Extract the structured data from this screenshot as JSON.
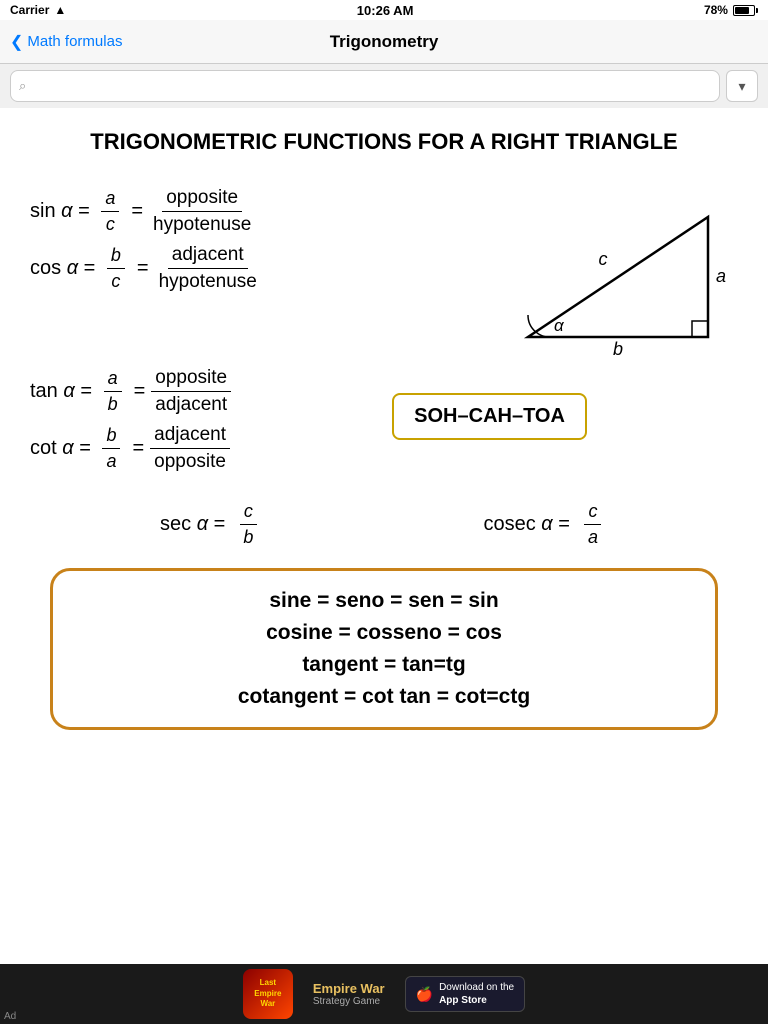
{
  "status": {
    "carrier": "Carrier",
    "wifi": "WiFi",
    "time": "10:26 AM",
    "battery": "78%"
  },
  "nav": {
    "back_label": "Math formulas",
    "title": "Trigonometry"
  },
  "search": {
    "placeholder": "",
    "dropdown_label": "▼"
  },
  "page": {
    "title": "TRIGONOMETRIC FUNCTIONS FOR A RIGHT TRIANGLE"
  },
  "formulas": {
    "sin_label": "sin α =",
    "sin_num": "a",
    "sin_den": "c",
    "sin_eq": "=",
    "sin_word_num": "opposite",
    "sin_word_den": "hypotenuse",
    "cos_label": "cos α =",
    "cos_num": "b",
    "cos_den": "c",
    "cos_eq": "=",
    "cos_word_num": "adjacent",
    "cos_word_den": "hypotenuse",
    "tan_label": "tan α =",
    "tan_num": "a",
    "tan_den": "b",
    "tan_eq": "=",
    "tan_word_num": "opposite",
    "tan_word_den": "adjacent",
    "cot_label": "cot α =",
    "cot_num": "b",
    "cot_den": "a",
    "cot_eq": "=",
    "cot_word_num": "adjacent",
    "cot_word_den": "opposite",
    "sec_label": "sec α =",
    "sec_num": "c",
    "sec_den": "b",
    "cosec_label": "cosec α =",
    "cosec_num": "c",
    "cosec_den": "a"
  },
  "sohtoa": {
    "label": "SOH–CAH–TOA"
  },
  "triangle": {
    "side_a": "a",
    "side_b": "b",
    "side_c": "c",
    "angle": "α"
  },
  "equivalences": {
    "line1": "sine = seno = sen = sin",
    "line2": "cosine = cosseno = cos",
    "line3": "tangent = tan=tg",
    "line4": "cotangent = cot tan = cot=ctg"
  },
  "ad": {
    "game_title": "Last\nEmpire\nWar",
    "app_store_label": "Download on the\nApp Store",
    "ad_label": "Ad"
  }
}
